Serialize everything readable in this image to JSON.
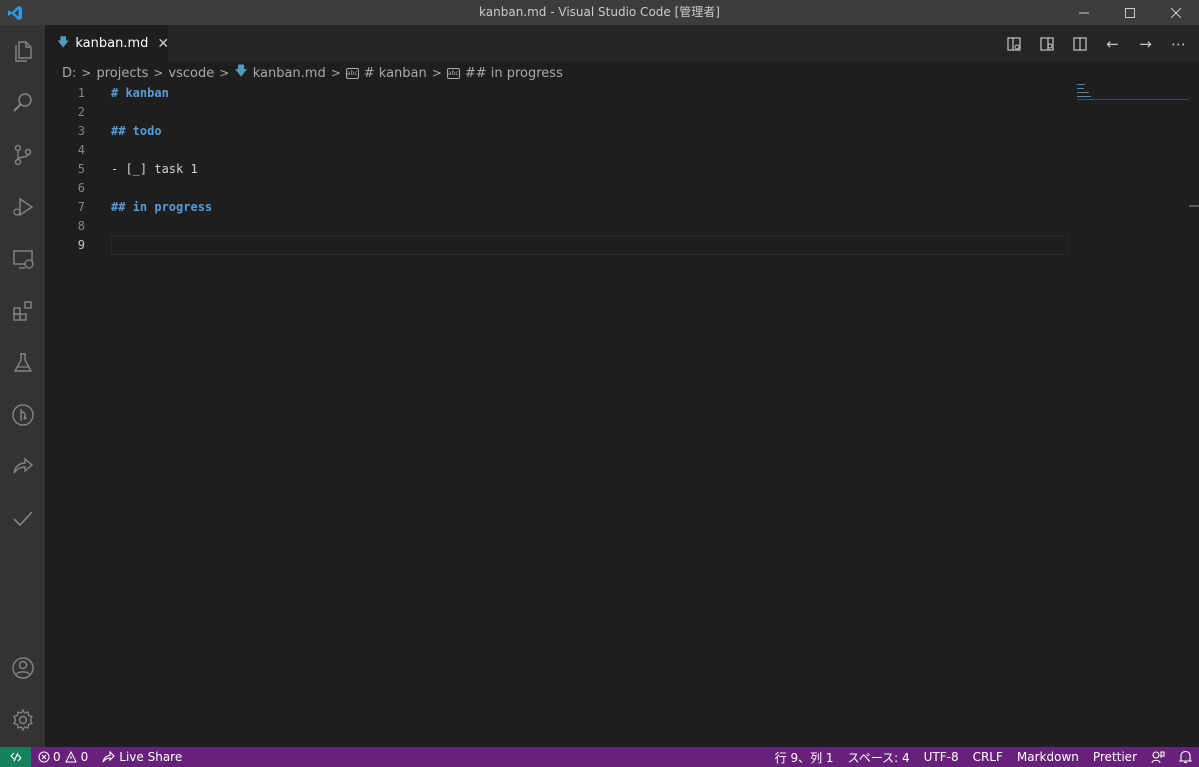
{
  "window": {
    "title": "kanban.md - Visual Studio Code [管理者]"
  },
  "activity_bar": {
    "items": [
      "files-icon",
      "search-icon",
      "source-control-icon",
      "run-debug-icon",
      "remote-explorer-icon",
      "extensions-icon",
      "testing-icon",
      "git-graph-icon",
      "live-share-icon",
      "todo-check-icon"
    ],
    "bottom": [
      "account-icon",
      "settings-gear-icon"
    ]
  },
  "tabs": [
    {
      "label": "kanban.md",
      "icon": "markdown-icon",
      "active": true
    }
  ],
  "breadcrumb": {
    "drive": "D:",
    "folder1": "projects",
    "folder2": "vscode",
    "file": "kanban.md",
    "symbol1": "# kanban",
    "symbol2": "## in progress"
  },
  "editor": {
    "lines": [
      {
        "num": "1",
        "text": "# kanban",
        "kind": "heading"
      },
      {
        "num": "2",
        "text": "",
        "kind": "plain"
      },
      {
        "num": "3",
        "text": "## todo",
        "kind": "heading"
      },
      {
        "num": "4",
        "text": "",
        "kind": "plain"
      },
      {
        "num": "5",
        "text": "- [_] task 1",
        "kind": "plain"
      },
      {
        "num": "6",
        "text": "",
        "kind": "plain"
      },
      {
        "num": "7",
        "text": "## in progress",
        "kind": "heading"
      },
      {
        "num": "8",
        "text": "",
        "kind": "plain"
      },
      {
        "num": "9",
        "text": "",
        "kind": "plain"
      }
    ],
    "active_line": 9
  },
  "status_bar": {
    "errors": "0",
    "warnings": "0",
    "live_share": "Live Share",
    "position": "行 9、列 1",
    "indent": "スペース: 4",
    "encoding": "UTF-8",
    "eol": "CRLF",
    "language": "Markdown",
    "formatter": "Prettier"
  },
  "colors": {
    "statusbar": "#68217a",
    "remote": "#16825d",
    "heading": "#569cd6"
  }
}
